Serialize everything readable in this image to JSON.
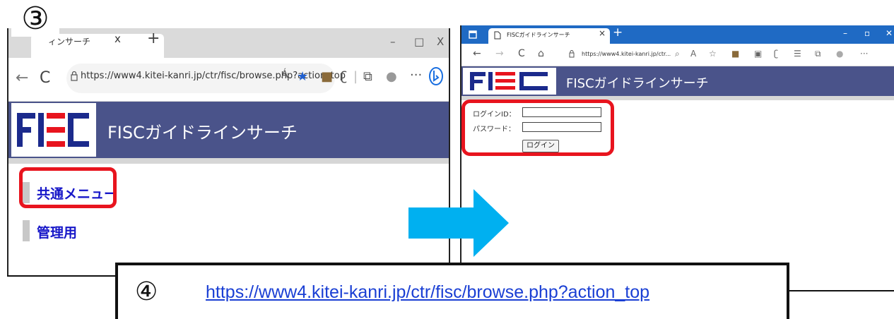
{
  "step3": {
    "number_label": "③"
  },
  "left_browser": {
    "tab_title": "ィンサーチ",
    "tab_close": "x",
    "new_tab": "+",
    "window_controls": {
      "minimize": "–",
      "maximize": "□",
      "close": "X"
    },
    "nav": {
      "back": "←",
      "reload": "C"
    },
    "url": "https://www4.kitei-kanri.jp/ctr/fisc/browse.php?action_top",
    "toolbar_icons": [
      "read-aloud-icon",
      "favorite-star-icon",
      "extension-icon",
      "feedback-icon",
      "collections-icon",
      "profile-icon",
      "more-icon",
      "bing-icon"
    ],
    "more_label": "···",
    "read_aloud_label": "Á",
    "logo_text": "FISC",
    "site_title": "FISCガイドラインサーチ",
    "menu": [
      {
        "label": "共通メニュー"
      },
      {
        "label": "管理用"
      }
    ]
  },
  "right_browser": {
    "tab_title": "FISCガイドラインサーチ",
    "tab_close": "×",
    "new_tab": "+",
    "window_controls": {
      "minimize": "–",
      "maximize": "▫",
      "close": "✕"
    },
    "nav": {
      "back": "←",
      "forward": "→",
      "reload": "C",
      "home": "⌂"
    },
    "url": "https://www4.kitei-kanri.jp/ctr...",
    "more_label": "···",
    "logo_text": "FISC",
    "site_title": "FISCガイドラインサーチ",
    "login_form": {
      "id_label": "ログインID：",
      "password_label": "パスワード：",
      "id_value": "",
      "password_value": "",
      "submit_label": "ログイン"
    }
  },
  "step4": {
    "number_label": "④",
    "url_link": "https://www4.kitei-kanri.jp/ctr/fisc/browse.php?action_top"
  },
  "colors": {
    "fisc_header": "#4a538a",
    "highlight_red": "#e8141e",
    "arrow_blue": "#00b0f0",
    "menu_link_blue": "#1616c8",
    "edge_titlebar_blue": "#1f6ac4",
    "logo_red": "#e8141e",
    "logo_navy": "#1b2a8c"
  }
}
